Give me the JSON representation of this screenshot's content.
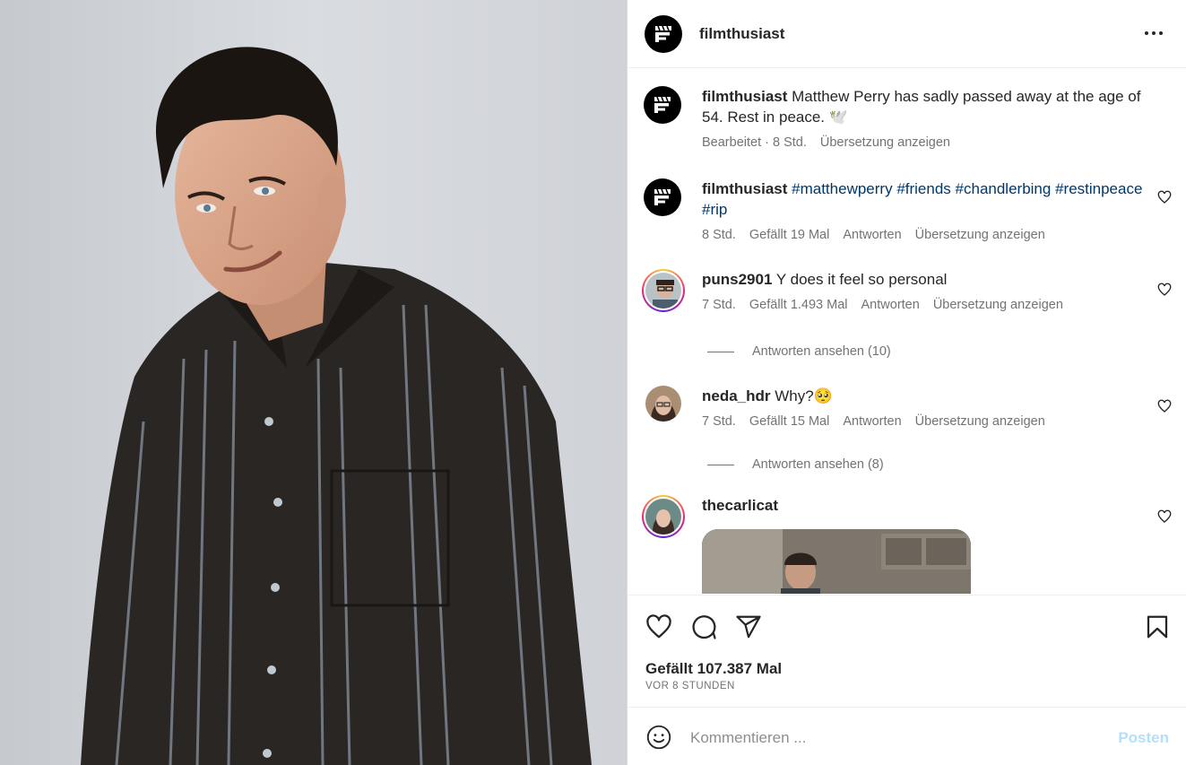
{
  "post": {
    "username": "filmthusiast",
    "brand_color": "#000000",
    "image_alt": "Portrait of a smiling man in a dark striped shirt"
  },
  "caption": {
    "username": "filmthusiast",
    "text": "Matthew Perry has sadly passed away at the age of 54. Rest in peace. 🕊️",
    "edited": "Bearbeitet",
    "time": "8 Std.",
    "translate": "Übersetzung anzeigen"
  },
  "comments": [
    {
      "username": "filmthusiast",
      "hashtags": [
        "#matthewperry",
        "#friends",
        "#chandlerbing",
        "#restinpeace",
        "#rip"
      ],
      "time": "8 Std.",
      "likes": "Gefällt 19 Mal",
      "reply": "Antworten",
      "translate": "Übersetzung anzeigen"
    },
    {
      "username": "puns2901",
      "text": "Y does it feel so personal",
      "time": "7 Std.",
      "likes": "Gefällt 1.493 Mal",
      "reply": "Antworten",
      "translate": "Übersetzung anzeigen",
      "view_replies": "Antworten ansehen (10)"
    },
    {
      "username": "neda_hdr",
      "text": "Why?🥺",
      "time": "7 Std.",
      "likes": "Gefällt 15 Mal",
      "reply": "Antworten",
      "translate": "Übersetzung anzeigen",
      "view_replies": "Antworten ansehen (8)"
    },
    {
      "username": "thecarlicat"
    }
  ],
  "actions": {
    "like_count": "Gefällt 107.387 Mal",
    "time_ago": "VOR 8 STUNDEN"
  },
  "composer": {
    "placeholder": "Kommentieren ...",
    "post_label": "Posten",
    "post_color": "#b2dffc"
  },
  "icons": {
    "more": "more-options-icon",
    "like": "heart-icon",
    "comment": "comment-icon",
    "share": "share-icon",
    "save": "bookmark-icon",
    "emoji": "emoji-icon"
  }
}
